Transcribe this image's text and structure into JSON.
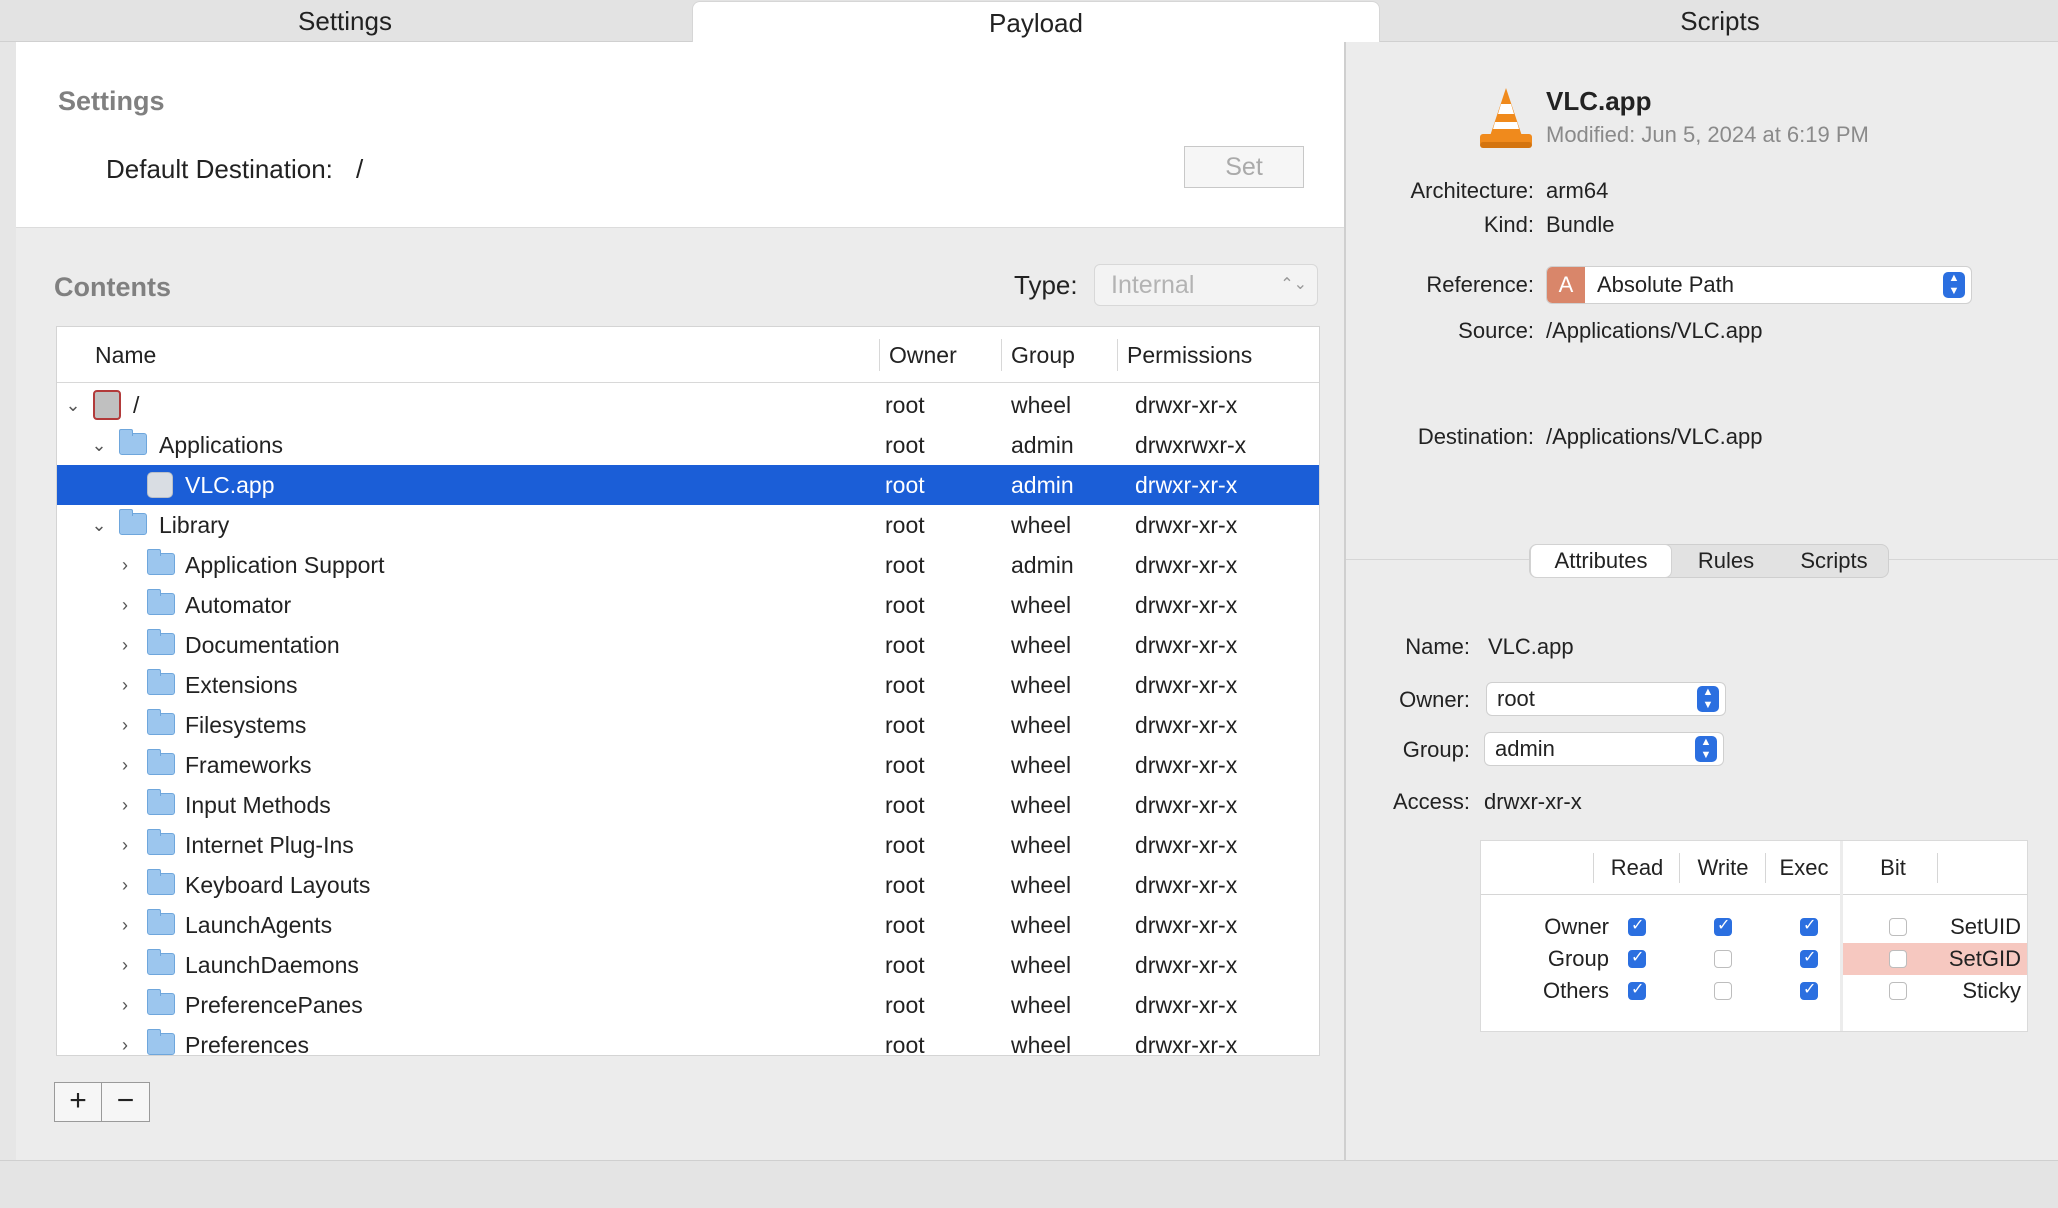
{
  "tabs": [
    {
      "label": "Settings",
      "active": false
    },
    {
      "label": "Payload",
      "active": true
    },
    {
      "label": "Scripts",
      "active": false
    }
  ],
  "settings": {
    "title": "Settings",
    "default_destination_label": "Default Destination:",
    "default_destination_value": "/",
    "set_button": "Set"
  },
  "contents": {
    "title": "Contents",
    "type_label": "Type:",
    "type_value": "Internal",
    "columns": [
      "Name",
      "Owner",
      "Group",
      "Permissions"
    ],
    "rows": [
      {
        "name": "/",
        "owner": "root",
        "group": "wheel",
        "perms": "drwxr-xr-x"
      },
      {
        "name": "Applications",
        "owner": "root",
        "group": "admin",
        "perms": "drwxrwxr-x"
      },
      {
        "name": "VLC.app",
        "owner": "root",
        "group": "admin",
        "perms": "drwxr-xr-x"
      },
      {
        "name": "Library",
        "owner": "root",
        "group": "wheel",
        "perms": "drwxr-xr-x"
      },
      {
        "name": "Application Support",
        "owner": "root",
        "group": "admin",
        "perms": "drwxr-xr-x"
      },
      {
        "name": "Automator",
        "owner": "root",
        "group": "wheel",
        "perms": "drwxr-xr-x"
      },
      {
        "name": "Documentation",
        "owner": "root",
        "group": "wheel",
        "perms": "drwxr-xr-x"
      },
      {
        "name": "Extensions",
        "owner": "root",
        "group": "wheel",
        "perms": "drwxr-xr-x"
      },
      {
        "name": "Filesystems",
        "owner": "root",
        "group": "wheel",
        "perms": "drwxr-xr-x"
      },
      {
        "name": "Frameworks",
        "owner": "root",
        "group": "wheel",
        "perms": "drwxr-xr-x"
      },
      {
        "name": "Input Methods",
        "owner": "root",
        "group": "wheel",
        "perms": "drwxr-xr-x"
      },
      {
        "name": "Internet Plug-Ins",
        "owner": "root",
        "group": "wheel",
        "perms": "drwxr-xr-x"
      },
      {
        "name": "Keyboard Layouts",
        "owner": "root",
        "group": "wheel",
        "perms": "drwxr-xr-x"
      },
      {
        "name": "LaunchAgents",
        "owner": "root",
        "group": "wheel",
        "perms": "drwxr-xr-x"
      },
      {
        "name": "LaunchDaemons",
        "owner": "root",
        "group": "wheel",
        "perms": "drwxr-xr-x"
      },
      {
        "name": "PreferencePanes",
        "owner": "root",
        "group": "wheel",
        "perms": "drwxr-xr-x"
      },
      {
        "name": "Preferences",
        "owner": "root",
        "group": "wheel",
        "perms": "drwxr-xr-x"
      }
    ],
    "add_button": "+",
    "remove_button": "−"
  },
  "inspector": {
    "app_name": "VLC.app",
    "modified": "Modified:  Jun 5, 2024 at 6:19 PM",
    "architecture_label": "Architecture:",
    "architecture_value": "arm64",
    "kind_label": "Kind:",
    "kind_value": "Bundle",
    "reference_label": "Reference:",
    "reference_badge": "A",
    "reference_value": "Absolute Path",
    "source_label": "Source:",
    "source_value": "/Applications/VLC.app",
    "destination_label": "Destination:",
    "destination_value": "/Applications/VLC.app"
  },
  "attributes": {
    "segments": [
      "Attributes",
      "Rules",
      "Scripts"
    ],
    "name_label": "Name:",
    "name_value": "VLC.app",
    "owner_label": "Owner:",
    "owner_value": "root",
    "group_label": "Group:",
    "group_value": "admin",
    "access_label": "Access:",
    "access_value": "drwxr-xr-x",
    "perm_columns": [
      "Read",
      "Write",
      "Exec",
      "Bit"
    ],
    "perm_rows": [
      {
        "label": "Owner",
        "read": true,
        "write": true,
        "exec": true,
        "bit_checked": false,
        "bit_label": "SetUID"
      },
      {
        "label": "Group",
        "read": true,
        "write": false,
        "exec": true,
        "bit_checked": false,
        "bit_label": "SetGID"
      },
      {
        "label": "Others",
        "read": true,
        "write": false,
        "exec": true,
        "bit_checked": false,
        "bit_label": "Sticky"
      }
    ]
  },
  "colors": {
    "selection": "#1b5ed7",
    "accent": "#2b6fe0",
    "setgid_highlight": "#f6c8c0"
  }
}
